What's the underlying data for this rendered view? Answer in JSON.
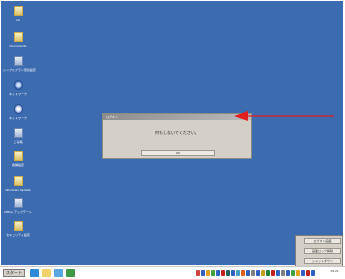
{
  "desktop": {
    "icons": [
      {
        "label": "Ist",
        "type": "folder"
      },
      {
        "label": "Documents",
        "type": "folder"
      },
      {
        "label": "シンプルプラン環境設定",
        "type": "pc"
      },
      {
        "label": "ネットワーク",
        "type": "net"
      },
      {
        "label": "ネットワーク",
        "type": "net2"
      },
      {
        "label": "ごみ箱",
        "type": "pc"
      },
      {
        "label": "各種設定",
        "type": "folder"
      },
      {
        "label": "Windows Update",
        "type": "folder"
      },
      {
        "label": "Office アップデート",
        "type": "pc"
      },
      {
        "label": "セキュリティ設定",
        "type": "folder"
      }
    ]
  },
  "dialog": {
    "title": "ログオン",
    "message": "何もしないでください。",
    "ok_label": "OK"
  },
  "tray_popup": {
    "buttons": [
      "ログオン画面",
      "画面ロック解除",
      "シャットダウン"
    ]
  },
  "taskbar": {
    "start_label": "スタート",
    "clock": "18:21"
  },
  "colors": {
    "desktop": "#3c6bb0",
    "arrow": "#e02020",
    "dialog": "#d4d0c8"
  }
}
